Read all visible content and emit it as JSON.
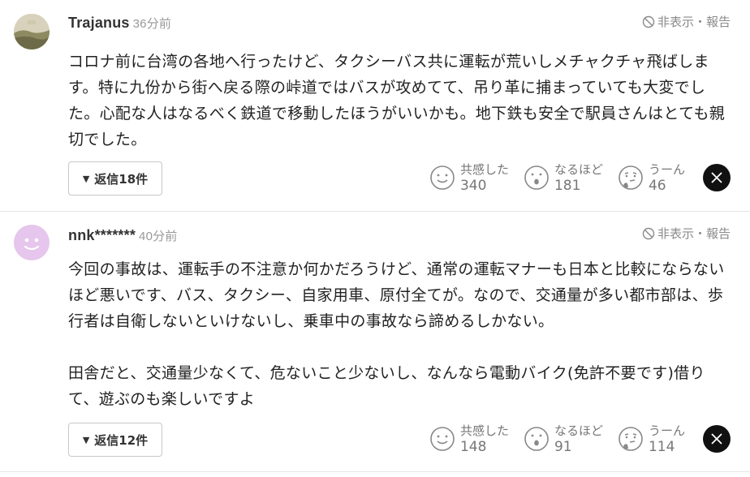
{
  "comments": [
    {
      "username": "Trajanus",
      "time": "36分前",
      "report_label": "非表示・報告",
      "body": "コロナ前に台湾の各地へ行ったけど、タクシーバス共に運転が荒いしメチャクチャ飛ばします。特に九份から街へ戻る際の峠道ではバスが攻めてて、吊り革に捕まっていても大変でした。心配な人はなるべく鉄道で移動したほうがいいかも。地下鉄も安全で駅員さんはとても親切でした。",
      "reply_label": "返信18件",
      "reactions": [
        {
          "label": "共感した",
          "count": "340"
        },
        {
          "label": "なるほど",
          "count": "181"
        },
        {
          "label": "うーん",
          "count": "46"
        }
      ]
    },
    {
      "username": "nnk*******",
      "time": "40分前",
      "report_label": "非表示・報告",
      "body": "今回の事故は、運転手の不注意か何かだろうけど、通常の運転マナーも日本と比較にならないほど悪いです、バス、タクシー、自家用車、原付全てが。なので、交通量が多い都市部は、歩行者は自衛しないといけないし、乗車中の事故なら諦めるしかない。\n\n田舎だと、交通量少なくて、危ないこと少ないし、なんなら電動バイク(免許不要です)借りて、遊ぶのも楽しいですよ",
      "reply_label": "返信12件",
      "reactions": [
        {
          "label": "共感した",
          "count": "148"
        },
        {
          "label": "なるほど",
          "count": "91"
        },
        {
          "label": "うーん",
          "count": "114"
        }
      ]
    }
  ]
}
